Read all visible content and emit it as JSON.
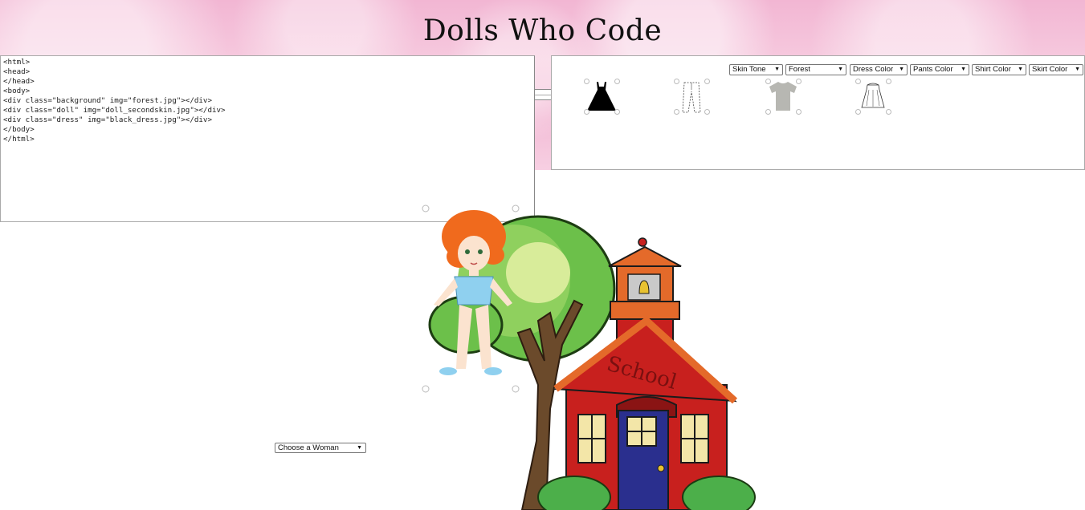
{
  "header": {
    "title": "Dolls Who Code"
  },
  "editor": {
    "lines": [
      "<html>",
      "<head>",
      "</head>",
      "<body>",
      "<div class=\"background\" img=\"forest.jpg\"></div>",
      "<div class=\"doll\" img=\"doll_secondskin.jpg\"></div>",
      "<div class=\"dress\" img=\"black_dress.jpg\"></div>",
      "</body>",
      "</html>"
    ]
  },
  "controls": {
    "skin_tone": "Skin Tone",
    "background": "Forest",
    "dress_color": "Dress Color",
    "pants_color": "Pants Color",
    "shirt_color": "Shirt Color",
    "skirt_color": "Skirt Color"
  },
  "wardrobe_items": [
    {
      "name": "dress",
      "color": "#000000"
    },
    {
      "name": "pants",
      "color": "#ffffff"
    },
    {
      "name": "shirt",
      "color": "#b7b7b2"
    },
    {
      "name": "skirt",
      "color": "#ffffff"
    }
  ],
  "scene": {
    "sign": "School"
  },
  "woman_select": {
    "label": "Choose a Woman"
  },
  "colors": {
    "brand_pink": "#f2b6d3",
    "school_red": "#c8201e",
    "door_blue": "#2a2f8e"
  }
}
